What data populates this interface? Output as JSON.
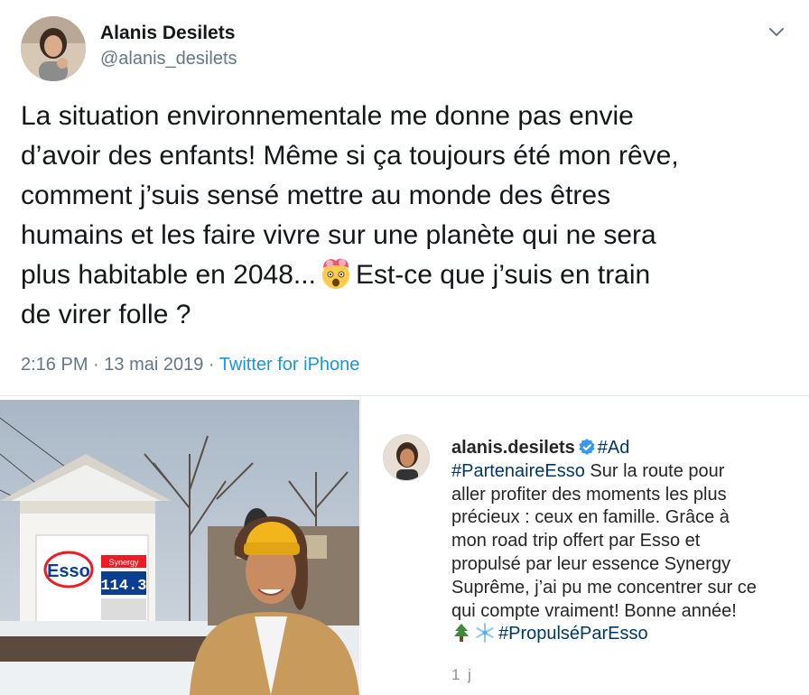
{
  "tweet": {
    "author": {
      "display_name": "Alanis Desilets",
      "handle": "@alanis_desilets",
      "avatar_icon": "profile-avatar"
    },
    "menu_icon": "chevron-down-icon",
    "text_lines": [
      "La situation environnementale me donne pas envie",
      "d’avoir des enfants! Même si ça toujours été mon rêve,",
      "comment j’suis sensé mettre au monde des êtres",
      "humains et les faire vivre sur une planète qui ne sera",
      "plus habitable en 2048...",
      "Est-ce que j’suis en train",
      "de virer folle ?"
    ],
    "emoji": "exploding-head",
    "time": "2:16 PM",
    "date": "13 mai 2019",
    "separator": "·",
    "source": "Twitter for iPhone"
  },
  "instagram": {
    "username": "alanis.desilets",
    "verified_icon": "verified-badge-icon",
    "caption_parts": {
      "tag_ad": "#Ad",
      "tag_partner": "#PartenaireEsso",
      "line1_rest": " Sur la route pour",
      "line2": "aller profiter des moments les plus",
      "line3": "précieux : ceux en famille. Grâce à",
      "line4": "mon road trip offert par Esso et",
      "line5": "propulsé par leur essence Synergy",
      "line6": "Suprême, j’ai pu me concentrer sur ce",
      "line7": "qui compte vraiment! Bonne année!",
      "tag_propulse": "#PropulséParEsso"
    },
    "emojis": [
      "evergreen-tree",
      "snowflake"
    ],
    "time_ago": "1 j",
    "photo": {
      "sign_brand": "Esso",
      "sign_product": "Synergy",
      "sign_price": "114.3"
    }
  },
  "colors": {
    "link_blue": "#1b95e0",
    "meta_gray": "#657786",
    "ig_link": "#00376b",
    "esso_red": "#ed1c24",
    "esso_blue": "#0b3e91",
    "hat_yellow": "#f2b51c"
  }
}
